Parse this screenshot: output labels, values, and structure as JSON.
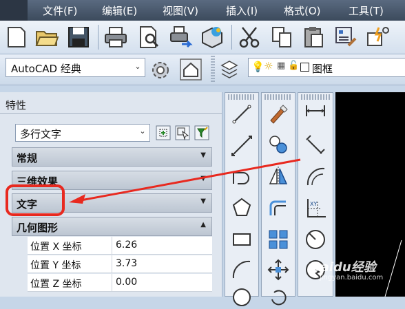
{
  "menu": [
    "文件(F)",
    "编辑(E)",
    "视图(V)",
    "插入(I)",
    "格式(O)",
    "工具(T)"
  ],
  "workspace": "AutoCAD 经典",
  "layer_name": "图框",
  "panel": {
    "title": "特性",
    "object_type": "多行文字",
    "sections": [
      {
        "label": "常规",
        "state": "collapsed"
      },
      {
        "label": "三维效果",
        "state": "collapsed"
      },
      {
        "label": "文字",
        "state": "collapsed"
      },
      {
        "label": "几何图形",
        "state": "expanded"
      }
    ],
    "rows": [
      {
        "key": "位置 X 坐标",
        "value": "6.26"
      },
      {
        "key": "位置 Y 坐标",
        "value": "3.73"
      },
      {
        "key": "位置 Z 坐标",
        "value": "0.00"
      }
    ]
  },
  "watermark": "Baidu经验",
  "watermark_url": "jingyan.baidu.com",
  "colors": {
    "annotation": "#e8291f",
    "canvas": "#000000"
  }
}
